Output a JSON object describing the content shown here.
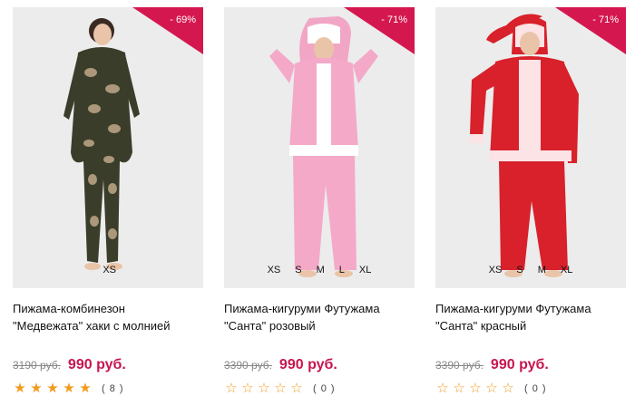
{
  "colors": {
    "badge": "#d4184f",
    "price": "#c8154f",
    "star": "#f39a1b"
  },
  "products": [
    {
      "discount": "- 69%",
      "sizes": [
        "XS"
      ],
      "title_line1": "Пижама-комбинезон",
      "title_line2": "\"Медвежата\" хаки с молнией",
      "old_price": "3190 руб.",
      "price": "990 руб.",
      "rating": 5,
      "stars": [
        "★",
        "★",
        "★",
        "★",
        "★"
      ],
      "reviews": "( 8 )"
    },
    {
      "discount": "- 71%",
      "sizes": [
        "XS",
        "S",
        "M",
        "L",
        "XL"
      ],
      "title_line1": "Пижама-кигуруми Футужама",
      "title_line2": "\"Санта\" розовый",
      "old_price": "3390 руб.",
      "price": "990 руб.",
      "rating": 0,
      "stars": [
        "☆",
        "☆",
        "☆",
        "☆",
        "☆"
      ],
      "reviews": "( 0 )"
    },
    {
      "discount": "- 71%",
      "sizes": [
        "XS",
        "S",
        "M",
        "XL"
      ],
      "title_line1": "Пижама-кигуруми Футужама",
      "title_line2": "\"Санта\" красный",
      "old_price": "3390 руб.",
      "price": "990 руб.",
      "rating": 0,
      "stars": [
        "☆",
        "☆",
        "☆",
        "☆",
        "☆"
      ],
      "reviews": "( 0 )"
    }
  ]
}
